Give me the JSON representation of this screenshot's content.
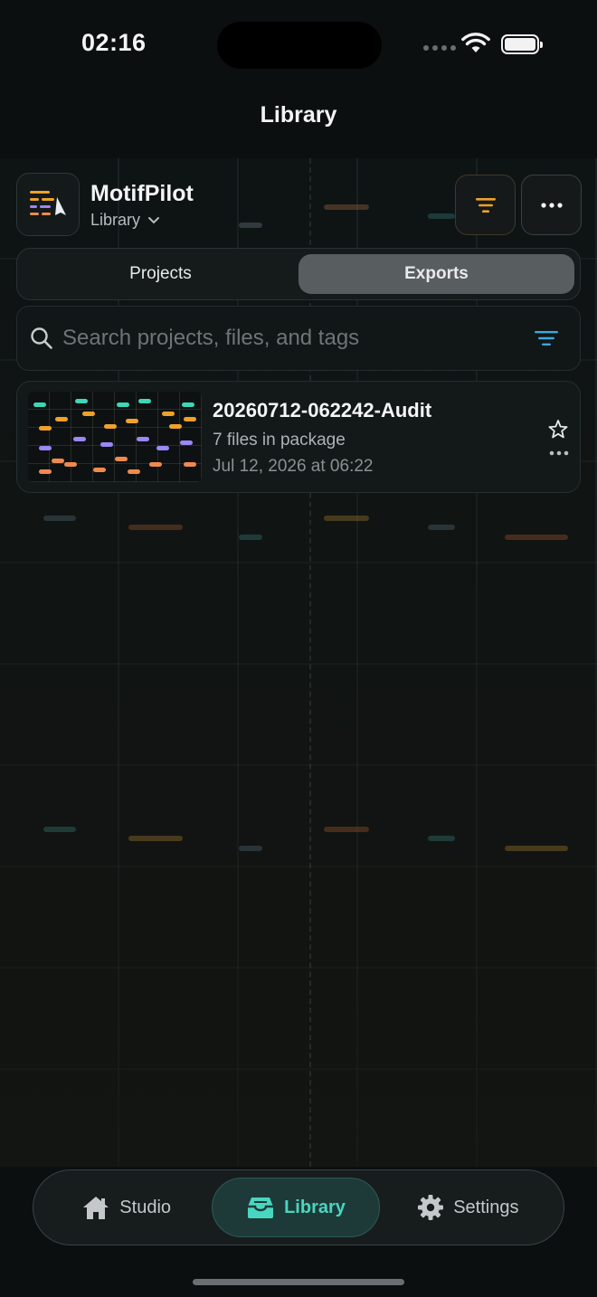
{
  "status": {
    "time": "02:16"
  },
  "nav": {
    "title": "Library"
  },
  "header": {
    "app_name": "MotifPilot",
    "subtitle": "Library"
  },
  "segments": [
    {
      "label": "Projects",
      "active": false
    },
    {
      "label": "Exports",
      "active": true
    }
  ],
  "search": {
    "placeholder": "Search projects, files, and tags"
  },
  "items": [
    {
      "title": "20260712-062242-Audit",
      "files": "7 files in package",
      "date": "Jul 12, 2026 at 06:22",
      "starred": false
    }
  ],
  "tabbar": {
    "tabs": [
      {
        "label": "Studio",
        "icon": "house-icon",
        "active": false
      },
      {
        "label": "Library",
        "icon": "tray-icon",
        "active": true
      },
      {
        "label": "Settings",
        "icon": "gear-icon",
        "active": false
      }
    ]
  },
  "colors": {
    "accent": "#49d6c0",
    "orange": "#f0a12a",
    "purple": "#9b87f5",
    "coral": "#ef8a4e",
    "teal": "#3fd6b6",
    "blue": "#3aa9e0"
  }
}
